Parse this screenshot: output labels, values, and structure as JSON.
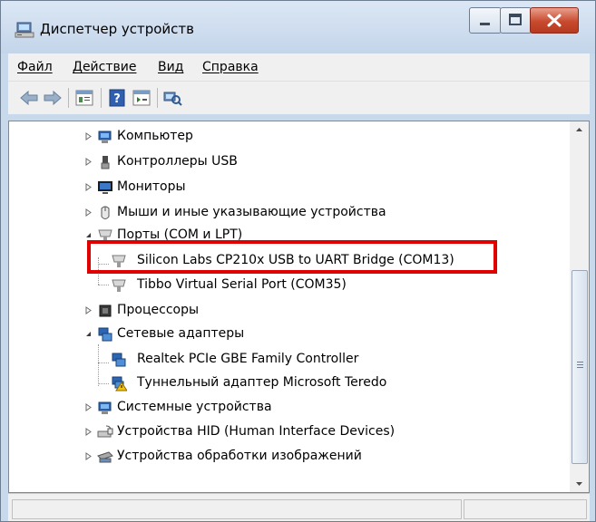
{
  "window": {
    "title": "Диспетчер устройств"
  },
  "menu": [
    "Файл",
    "Действие",
    "Вид",
    "Справка"
  ],
  "toolbar": {
    "buttons": [
      "back-icon",
      "forward-icon",
      "properties-icon",
      "help-icon",
      "details-icon",
      "scan-hardware-icon"
    ]
  },
  "tree": {
    "items": [
      {
        "label": "Компьютер",
        "icon": "computer-icon",
        "expanded": false
      },
      {
        "label": "Контроллеры USB",
        "icon": "usb-icon",
        "expanded": false
      },
      {
        "label": "Мониторы",
        "icon": "monitor-icon",
        "expanded": false
      },
      {
        "label": "Мыши и иные указывающие устройства",
        "icon": "mouse-icon",
        "expanded": false
      },
      {
        "label": "Порты (COM и LPT)",
        "icon": "port-icon",
        "expanded": true,
        "children": [
          {
            "label": "Silicon Labs CP210x USB to UART Bridge (COM13)",
            "icon": "port-icon",
            "highlighted": true
          },
          {
            "label": "Tibbo Virtual Serial Port (COM35)",
            "icon": "port-icon"
          }
        ]
      },
      {
        "label": "Процессоры",
        "icon": "cpu-icon",
        "expanded": false
      },
      {
        "label": "Сетевые адаптеры",
        "icon": "network-icon",
        "expanded": true,
        "children": [
          {
            "label": "Realtek PCIe GBE Family Controller",
            "icon": "network-icon"
          },
          {
            "label": "Туннельный адаптер Microsoft Teredo",
            "icon": "network-warning-icon"
          }
        ]
      },
      {
        "label": "Системные устройства",
        "icon": "system-icon",
        "expanded": false
      },
      {
        "label": "Устройства HID (Human Interface Devices)",
        "icon": "hid-icon",
        "expanded": false
      },
      {
        "label": "Устройства обработки изображений",
        "icon": "imaging-icon",
        "expanded": false
      }
    ]
  },
  "colors": {
    "highlight_border": "#e00000",
    "close_button": "#c84a2e",
    "frame": "#c9d9ec"
  }
}
